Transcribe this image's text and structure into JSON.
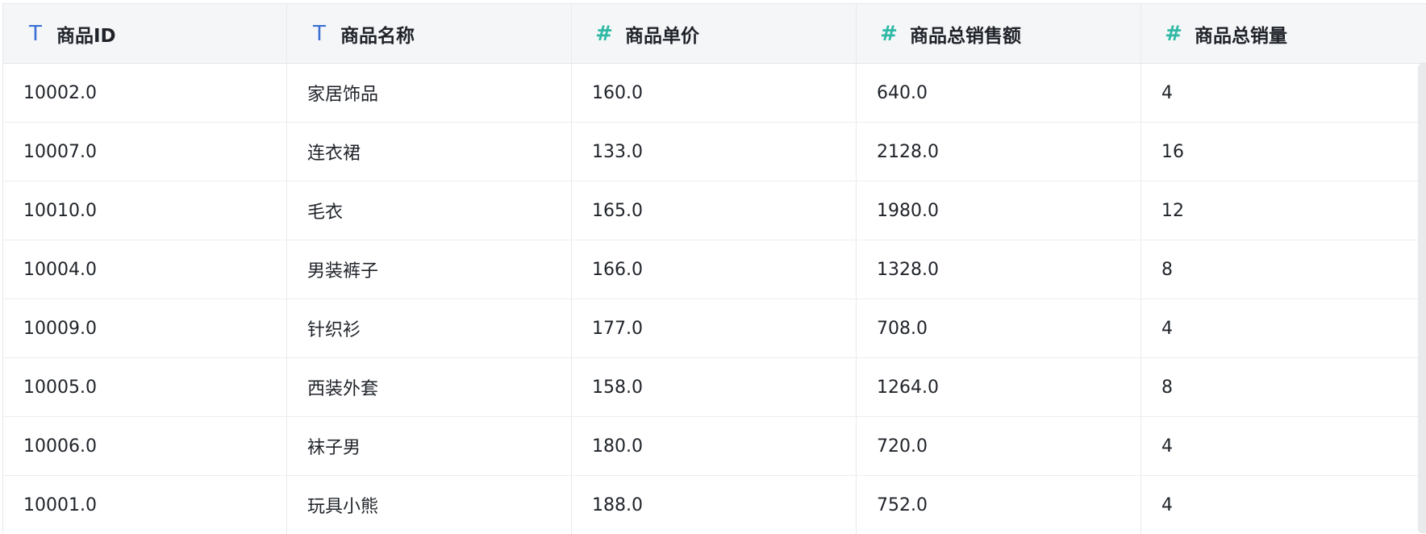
{
  "columns": [
    {
      "label": "商品ID",
      "type_icon": "T",
      "icon_name": "text-type-icon"
    },
    {
      "label": "商品名称",
      "type_icon": "T",
      "icon_name": "text-type-icon"
    },
    {
      "label": "商品单价",
      "type_icon": "#",
      "icon_name": "number-type-icon"
    },
    {
      "label": "商品总销售额",
      "type_icon": "#",
      "icon_name": "number-type-icon"
    },
    {
      "label": "商品总销量",
      "type_icon": "#",
      "icon_name": "number-type-icon"
    }
  ],
  "rows": [
    [
      "10002.0",
      "家居饰品",
      "160.0",
      "640.0",
      "4"
    ],
    [
      "10007.0",
      "连衣裙",
      "133.0",
      "2128.0",
      "16"
    ],
    [
      "10010.0",
      "毛衣",
      "165.0",
      "1980.0",
      "12"
    ],
    [
      "10004.0",
      "男装裤子",
      "166.0",
      "1328.0",
      "8"
    ],
    [
      "10009.0",
      "针织衫",
      "177.0",
      "708.0",
      "4"
    ],
    [
      "10005.0",
      "西装外套",
      "158.0",
      "1264.0",
      "8"
    ],
    [
      "10006.0",
      "袜子男",
      "180.0",
      "720.0",
      "4"
    ],
    [
      "10001.0",
      "玩具小熊",
      "188.0",
      "752.0",
      "4"
    ]
  ],
  "colors": {
    "text_icon": "#3b6fd4",
    "number_icon": "#2fb9a5",
    "header_bg": "#f5f6f8"
  }
}
